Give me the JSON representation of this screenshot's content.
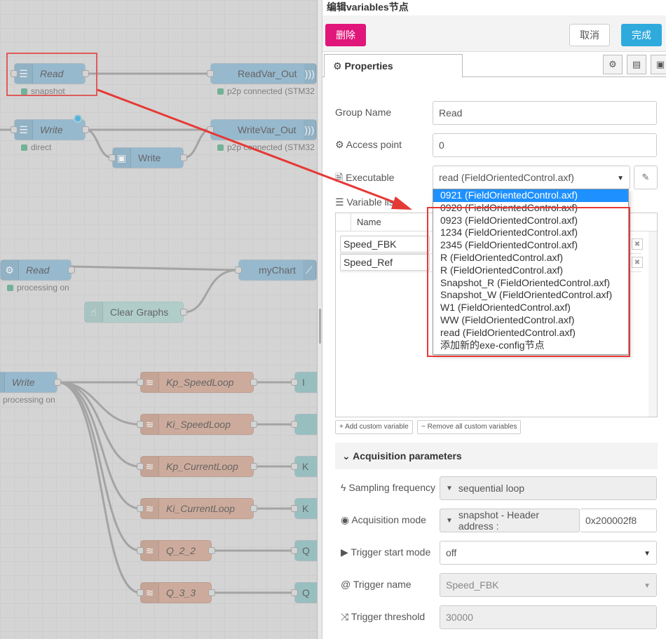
{
  "flow": {
    "nodes": {
      "read1": {
        "label": "Read",
        "status": "snapshot"
      },
      "readvar_out": {
        "label": "ReadVar_Out",
        "status": "p2p connected (STM32"
      },
      "write1": {
        "label": "Write",
        "status": "direct"
      },
      "writevar_out": {
        "label": "WriteVar_Out",
        "status": "p2p connected (STM32"
      },
      "write_debug": {
        "label": "Write"
      },
      "read2": {
        "label": "Read",
        "status": "processing on"
      },
      "mychart": {
        "label": "myChart"
      },
      "clear_graphs": {
        "label": "Clear Graphs"
      },
      "write2": {
        "label": "Write",
        "status": "processing on"
      },
      "kp_speed": {
        "label": "Kp_SpeedLoop"
      },
      "ki_speed": {
        "label": "Ki_SpeedLoop"
      },
      "kp_current": {
        "label": "Kp_CurrentLoop"
      },
      "ki_current": {
        "label": "Ki_CurrentLoop"
      },
      "q22": {
        "label": "Q_2_2"
      },
      "q33": {
        "label": "Q_3_3"
      },
      "out1": {
        "label": "I"
      },
      "out3": {
        "label": "K"
      },
      "out4": {
        "label": "K"
      },
      "out5": {
        "label": "Q"
      },
      "out6": {
        "label": "Q"
      }
    }
  },
  "panel": {
    "title": "编辑variables节点",
    "delete_label": "删除",
    "cancel_label": "取消",
    "done_label": "完成",
    "tab_label": "Properties",
    "group_name_label": "Group Name",
    "group_name_value": "Read",
    "access_point_label": "Access point",
    "access_point_value": "0",
    "executable_label": "Executable",
    "executable_value": "read (FieldOrientedControl.axf)",
    "variable_list_label": "Variable list",
    "column_name": "Name",
    "variables": [
      "Speed_FBK",
      "Speed_Ref"
    ],
    "add_custom_label": "Add custom variable",
    "remove_all_label": "Remove all custom variables",
    "acq_section_label": "Acquisition parameters",
    "sampling_label": "Sampling frequency",
    "sampling_value": "sequential loop",
    "acq_mode_label": "Acquisition mode",
    "acq_mode_value": "snapshot - Header address :",
    "acq_mode_address": "0x200002f8",
    "trigger_start_label": "Trigger start mode",
    "trigger_start_value": "off",
    "trigger_name_label": "Trigger name",
    "trigger_name_value": "Speed_FBK",
    "trigger_threshold_label": "Trigger threshold",
    "trigger_threshold_value": "30000"
  },
  "executable_options": [
    "0921 (FieldOrientedControl.axf)",
    "0920 (FieldOrientedControl.axf)",
    "0923 (FieldOrientedControl.axf)",
    "1234 (FieldOrientedControl.axf)",
    "2345 (FieldOrientedControl.axf)",
    "R (FieldOrientedControl.axf)",
    "R (FieldOrientedControl.axf)",
    "Snapshot_R (FieldOrientedControl.axf)",
    "Snapshot_W (FieldOrientedControl.axf)",
    "W1 (FieldOrientedControl.axf)",
    "WW (FieldOrientedControl.axf)",
    "read (FieldOrientedControl.axf)",
    "添加新的exe-config节点"
  ],
  "colors": {
    "delete": "#e0167a",
    "done": "#2eaadc",
    "highlight": "#e53935",
    "selected_option": "#1e90ff"
  }
}
